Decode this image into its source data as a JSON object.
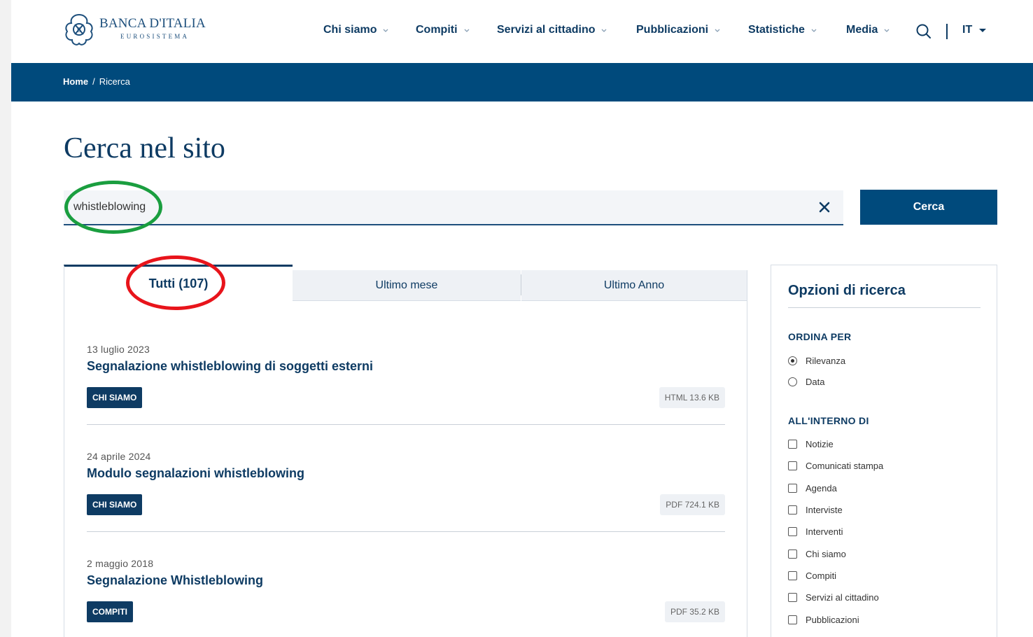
{
  "header": {
    "logo_name": "BANCA D'ITALIA",
    "logo_sub": "EUROSISTEMA",
    "nav": [
      "Chi siamo",
      "Compiti",
      "Servizi al cittadino",
      "Pubblicazioni",
      "Statistiche",
      "Media"
    ],
    "lang": "IT"
  },
  "breadcrumb": {
    "home": "Home",
    "separator": "/",
    "current": "Ricerca"
  },
  "page_title": "Cerca nel sito",
  "search": {
    "value": "whistleblowing",
    "button": "Cerca"
  },
  "tabs": [
    "Tutti (107)",
    "Ultimo mese",
    "Ultimo Anno"
  ],
  "results": [
    {
      "date": "13 luglio 2023",
      "title": "Segnalazione whistleblowing di soggetti esterni",
      "category": "CHI SIAMO",
      "file": "HTML  13.6 KB"
    },
    {
      "date": "24 aprile 2024",
      "title": "Modulo segnalazioni whistleblowing",
      "category": "CHI SIAMO",
      "file": "PDF  724.1 KB"
    },
    {
      "date": "2 maggio 2018",
      "title": "Segnalazione Whistleblowing",
      "category": "COMPITI",
      "file": "PDF  35.2 KB"
    }
  ],
  "sidebar": {
    "title": "Opzioni di ricerca",
    "sort_heading": "ORDINA PER",
    "sort_options": [
      "Rilevanza",
      "Data"
    ],
    "sort_selected": "Rilevanza",
    "within_heading": "ALL'INTERNO DI",
    "within_options": [
      "Notizie",
      "Comunicati stampa",
      "Agenda",
      "Interviste",
      "Interventi",
      "Chi siamo",
      "Compiti",
      "Servizi al cittadino",
      "Pubblicazioni"
    ]
  },
  "colors": {
    "brand_blue": "#004a7c",
    "text_blue": "#0e3b63",
    "annotation_green": "#1a9e3f",
    "annotation_red": "#e8141b"
  },
  "icons": [
    "bank-logo-icon",
    "chevron-down-icon",
    "search-icon",
    "close-icon",
    "caret-down-icon"
  ]
}
